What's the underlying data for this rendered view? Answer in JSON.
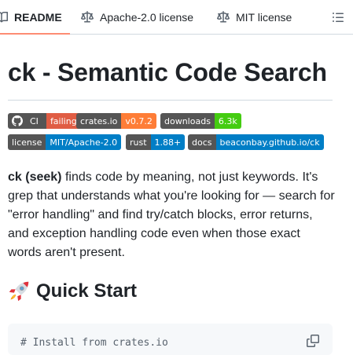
{
  "tabs": [
    {
      "label": "README",
      "icon": "book-icon",
      "active": true
    },
    {
      "label": "Apache-2.0 license",
      "icon": "law-icon",
      "active": false
    },
    {
      "label": "MIT license",
      "icon": "law-icon",
      "active": false
    }
  ],
  "outline_icon": "list-unordered-icon",
  "title": "ck - Semantic Code Search",
  "badges": [
    {
      "label": "CI",
      "message": "failing",
      "color": "#e05d44",
      "icon": "github-icon"
    },
    {
      "label": "crates.io",
      "message": "v0.7.2",
      "color": "#fe7d37"
    },
    {
      "label": "downloads",
      "message": "6.3k",
      "color": "#4c1"
    },
    {
      "label": "license",
      "message": "MIT/Apache-2.0",
      "color": "#007ec6"
    },
    {
      "label": "rust",
      "message": "1.88+",
      "color": "#007ec6"
    },
    {
      "label": "docs",
      "message": "beaconbay.github.io/ck",
      "color": "#007ec6"
    }
  ],
  "intro": {
    "strong": "ck (seek)",
    "rest": " finds code by meaning, not just keywords. It's grep that understands what you're looking for — search for \"error handling\" and find try/catch blocks, error returns, and exception handling code even when those exact words aren't present."
  },
  "quick_start": {
    "emoji": "rocket-icon",
    "heading": "Quick Start",
    "code_first_line": "# Install from crates.io",
    "copy_icon": "copy-icon"
  },
  "colors": {
    "tab_underline": "#fd8c73",
    "text": "#1f2328",
    "border": "#d1d9e0",
    "code_bg": "#f6f8fa"
  }
}
